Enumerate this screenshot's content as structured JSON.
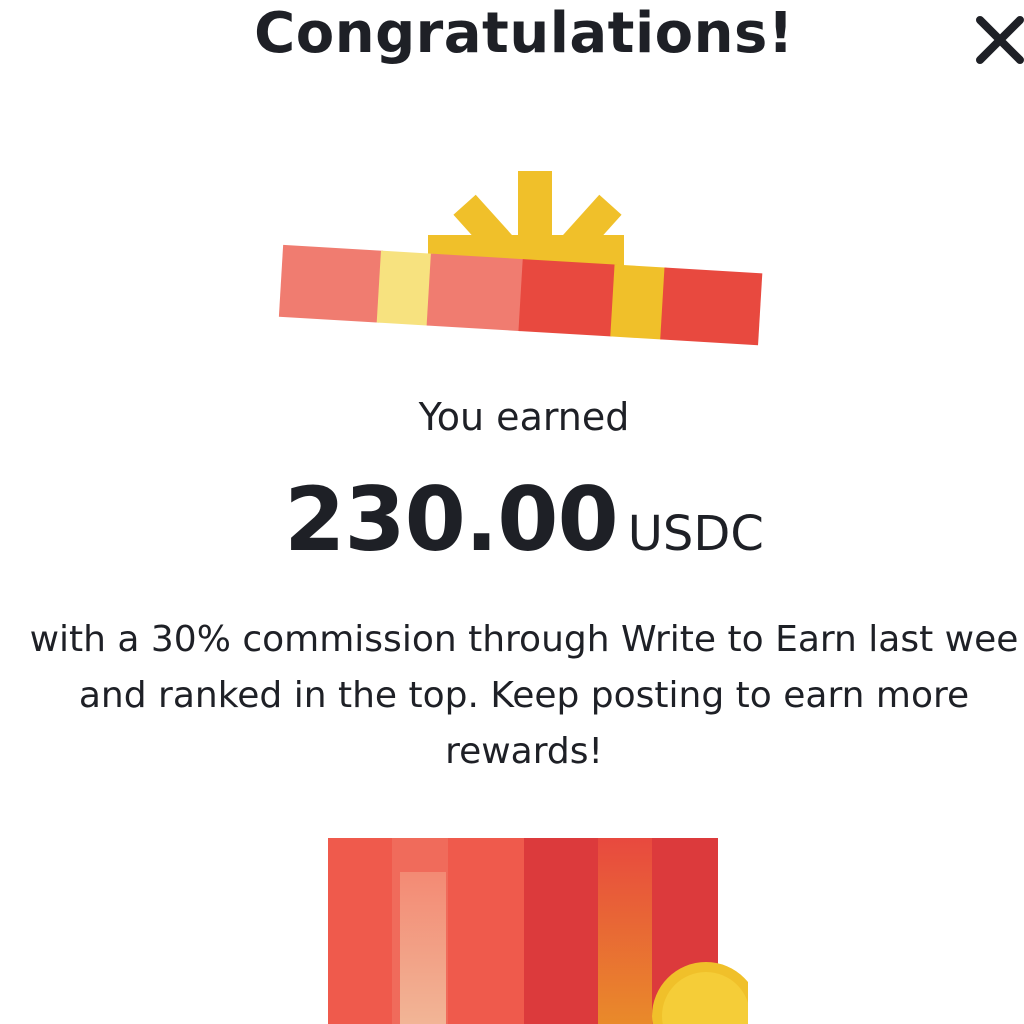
{
  "dialog": {
    "title": "Congratulations!",
    "close_icon": "close-icon",
    "earned_label": "You earned",
    "amount": "230.00",
    "unit": "USDC",
    "message_lines": [
      "with a 30% commission through Write to Earn last wee",
      "and ranked in the top. Keep posting to earn more",
      "rewards!"
    ],
    "illustration_icons": [
      "gift-lid-icon",
      "gift-box-icon",
      "coin-icon"
    ]
  },
  "colors": {
    "text": "#1e2026",
    "gift_red": "#e8493f",
    "gift_light_red": "#f07c70",
    "gift_yellow": "#f0c02a",
    "gift_light_yellow": "#f7e27f",
    "background": "#ffffff"
  }
}
